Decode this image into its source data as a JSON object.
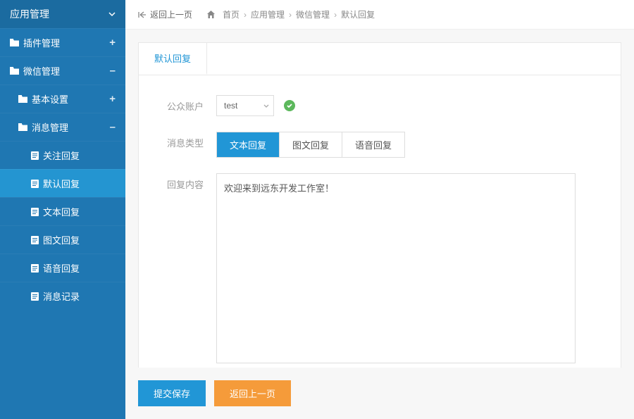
{
  "sidebar": {
    "header": {
      "label": "应用管理"
    },
    "items": [
      {
        "label": "插件管理",
        "icon": "folder",
        "badge": "+",
        "level": 1
      },
      {
        "label": "微信管理",
        "icon": "folder",
        "badge": "–",
        "level": 1
      },
      {
        "label": "基本设置",
        "icon": "folder",
        "badge": "+",
        "level": 2
      },
      {
        "label": "消息管理",
        "icon": "folder",
        "badge": "–",
        "level": 2
      },
      {
        "label": "关注回复",
        "icon": "doc",
        "level": 3
      },
      {
        "label": "默认回复",
        "icon": "doc",
        "level": 3,
        "active": true
      },
      {
        "label": "文本回复",
        "icon": "doc",
        "level": 3
      },
      {
        "label": "图文回复",
        "icon": "doc",
        "level": 3
      },
      {
        "label": "语音回复",
        "icon": "doc",
        "level": 3
      },
      {
        "label": "消息记录",
        "icon": "doc",
        "level": 3
      }
    ]
  },
  "topbar": {
    "back": "返回上一页",
    "crumbs": [
      "首页",
      "应用管理",
      "微信管理",
      "默认回复"
    ]
  },
  "panel": {
    "tab": "默认回复"
  },
  "form": {
    "account_label": "公众账户",
    "account_value": "test",
    "msgtype_label": "消息类型",
    "msgtypes": [
      {
        "label": "文本回复",
        "active": true
      },
      {
        "label": "图文回复"
      },
      {
        "label": "语音回复"
      }
    ],
    "content_label": "回复内容",
    "content_value": "欢迎来到远东开发工作室！"
  },
  "footer": {
    "submit": "提交保存",
    "back": "返回上一页"
  }
}
